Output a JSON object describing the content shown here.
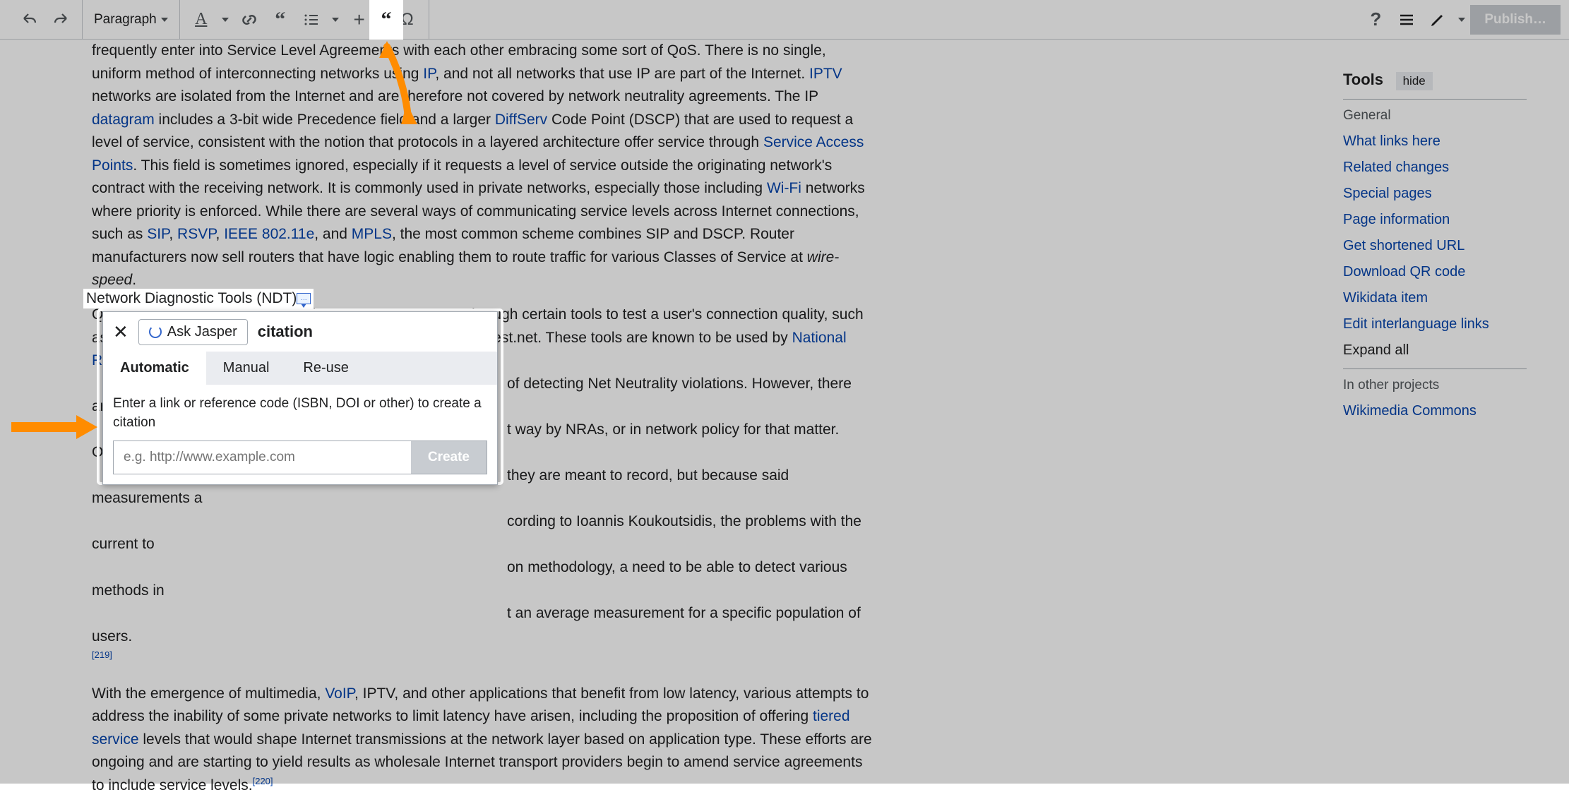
{
  "toolbar": {
    "format_label": "Paragraph",
    "publish_label": "Publish…"
  },
  "content": {
    "p1_a": "frequently enter into Service Level Agreements with each other embracing some sort of QoS. There is no single, uniform method of interconnecting networks using ",
    "l_ip": "IP",
    "p1_b": ", and not all networks that use IP are part of the Internet. ",
    "l_iptv": "IPTV",
    "p1_c": " networks are isolated from the Internet and are therefore not covered by network neutrality agreements. The IP ",
    "l_datagram": "datagram",
    "p1_d": " includes a 3-bit wide Precedence field and a larger ",
    "l_diffserv": "DiffServ",
    "p1_e": " Code Point (DSCP) that are used to request a level of service, consistent with the notion that protocols in a layered architecture offer service through ",
    "l_sap": "Service Access Points",
    "p1_f": ". This field is sometimes ignored, especially if it requests a level of service outside the originating network's contract with the receiving network. It is commonly used in private networks, especially those including ",
    "l_wifi": "Wi-Fi",
    "p1_g": " networks where priority is enforced. While there are several ways of communicating service levels across Internet connections, such as ",
    "l_sip": "SIP",
    "p1_c1": ", ",
    "l_rsvp": "RSVP",
    "p1_c2": ", ",
    "l_ieee": "IEEE 802.11e",
    "p1_c3": ", and ",
    "l_mpls": "MPLS",
    "p1_h": ", the most common scheme combines SIP and DSCP. Router manufacturers now sell routers that have logic enabling them to route traffic for various Classes of Service at ",
    "wirespeed": "wire-speed",
    "p1_end": ".",
    "p2_a": "Quality of service is sometimes taken as a measurement through certain tools to test a user's connection quality, such as Network Diagnostic Tools (NDT)",
    "ref_dots": "…",
    "p2_b": " and services on speedtest.net. These tools are known to be used by ",
    "l_nra": "National Regulatory A",
    "p2_c": "of detecting Net Neutrality violations. However, there are very fe",
    "p2_d": "t way by NRAs, or in network policy for that matter. Often, th",
    "p2_e": "they are meant to record, but because said measurements a",
    "p2_f": "cording to Ioannis Koukoutsidis, the problems with the current to",
    "p2_g": "on methodology, a need to be able to detect various methods in",
    "p2_h": "t an average measurement for a specific population of users.",
    "ref219": "[219]",
    "p3_a": "With the emergence of multimedia, ",
    "l_voip": "VoIP",
    "p3_b": ", IPTV, and other applications that benefit from low latency, various attempts to address the inability of some private networks to limit latency have arisen, including the proposition of offering ",
    "l_tiered": "tiered service",
    "p3_c": " levels that would shape Internet transmissions at the network layer based on application type. These efforts are ongoing and are starting to yield results as wholesale Internet transport providers begin to amend service agreements to include service levels.",
    "ref220": "[220]"
  },
  "tools": {
    "title": "Tools",
    "hide": "hide",
    "general": "General",
    "links": [
      "What links here",
      "Related changes",
      "Special pages",
      "Page information",
      "Get shortened URL",
      "Download QR code",
      "Wikidata item",
      "Edit interlanguage links"
    ],
    "expand": "Expand all",
    "other": "In other projects",
    "commons": "Wikimedia Commons"
  },
  "popup": {
    "ask": "Ask Jasper",
    "title": "citation",
    "tab1": "Automatic",
    "tab2": "Manual",
    "tab3": "Re-use",
    "desc": "Enter a link or reference code (ISBN, DOI or other) to create a citation",
    "placeholder": "e.g. http://www.example.com",
    "create": "Create"
  },
  "highlight": "Network Diagnostic Tools (NDT)"
}
